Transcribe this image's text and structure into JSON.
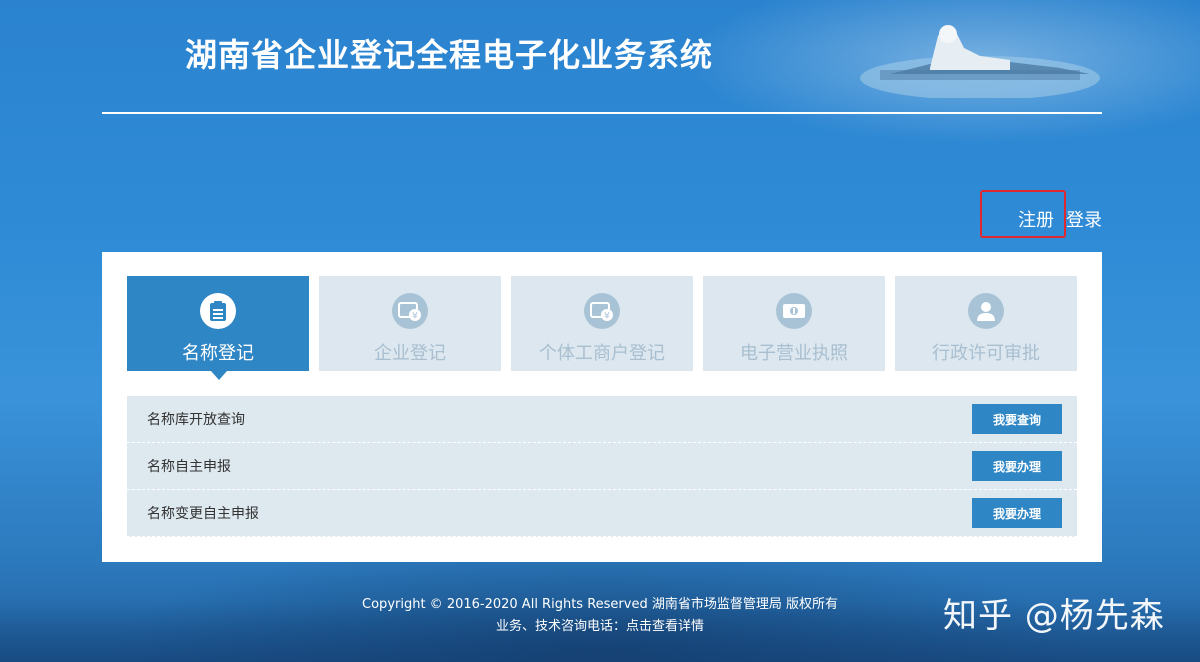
{
  "header": {
    "title": "湖南省企业登记全程电子化业务系统"
  },
  "auth": {
    "register_label": "注册",
    "login_label": "登录",
    "highlight_color": "#e0282e"
  },
  "tabs": [
    {
      "label": "名称登记",
      "icon": "document-icon",
      "active": true
    },
    {
      "label": "企业登记",
      "icon": "yuan-card-icon",
      "active": false
    },
    {
      "label": "个体工商户登记",
      "icon": "yuan-card-icon",
      "active": false
    },
    {
      "label": "电子营业执照",
      "icon": "money-icon",
      "active": false
    },
    {
      "label": "行政许可审批",
      "icon": "person-icon",
      "active": false
    }
  ],
  "services": [
    {
      "label": "名称库开放查询",
      "button": "我要查询"
    },
    {
      "label": "名称自主申报",
      "button": "我要办理"
    },
    {
      "label": "名称变更自主申报",
      "button": "我要办理"
    }
  ],
  "footer": {
    "copyright": "Copyright © 2016-2020 All Rights Reserved 湖南省市场监督管理局 版权所有",
    "hotline_prefix": "业务、技术咨询电话：",
    "hotline_link": "点击查看详情"
  },
  "watermark": "知乎 @杨先森",
  "colors": {
    "accent": "#2f86c5",
    "tab_inactive_bg": "#dce7ef",
    "row_bg": "#dde8ef"
  }
}
